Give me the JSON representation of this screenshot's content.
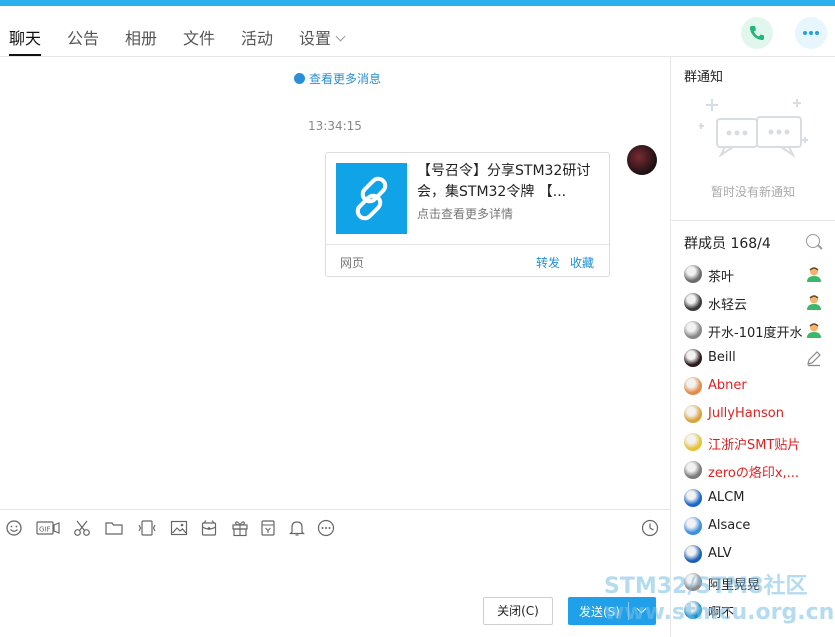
{
  "tabs": [
    {
      "label": "聊天",
      "active": true
    },
    {
      "label": "公告"
    },
    {
      "label": "相册"
    },
    {
      "label": "文件"
    },
    {
      "label": "活动"
    },
    {
      "label": "设置"
    }
  ],
  "header": {
    "phone_icon": "phone-icon",
    "more_icon": "more-icon"
  },
  "chat": {
    "more_messages": "查看更多消息",
    "timestamp": "13:34:15",
    "card": {
      "title": "【号召令】分享STM32研讨会，集STM32令牌 【...",
      "subtitle": "点击查看更多详情",
      "type": "网页",
      "forward": "转发",
      "favorite": "收藏",
      "thumb_icon": "link-icon"
    }
  },
  "toolbar": {
    "icons": [
      "emoji-icon",
      "gif-icon",
      "scissors-icon",
      "folder-icon",
      "shake-icon",
      "image-icon",
      "red-packet-icon",
      "gift-icon",
      "schedule-icon",
      "bell-icon",
      "more-icon",
      "history-icon"
    ],
    "close_label": "关闭(C)",
    "send_label": "发送(S)"
  },
  "notice": {
    "title": "群通知",
    "empty": "暂时没有新通知"
  },
  "members": {
    "title": "群成员",
    "count": "168/4",
    "list": [
      {
        "name": "茶叶",
        "color": "#222222",
        "role": "admin-icon"
      },
      {
        "name": "水轻云",
        "color": "#222222",
        "role": "admin-icon"
      },
      {
        "name": "开水-101度开水",
        "color": "#222222",
        "role": "admin-icon"
      },
      {
        "name": "Beill",
        "color": "#222222",
        "role": "edit-icon"
      },
      {
        "name": "Abner",
        "color": "#e02020"
      },
      {
        "name": "JullyHanson",
        "color": "#e02020"
      },
      {
        "name": "江浙沪SMT贴片",
        "color": "#e02020"
      },
      {
        "name": "zeroの烙印x,...",
        "color": "#e02020"
      },
      {
        "name": "ALCM",
        "color": "#222222"
      },
      {
        "name": "Alsace",
        "color": "#222222"
      },
      {
        "name": "ALV",
        "color": "#222222"
      },
      {
        "name": "阿里晃晃",
        "color": "#222222"
      },
      {
        "name": "啊不",
        "color": "#222222"
      }
    ]
  },
  "watermark": {
    "line1": "STM32/STM8社区",
    "line2": "www.stmcu.org.cn"
  },
  "colors": {
    "accent": "#1fa0e8",
    "link": "#1e90d8",
    "topbar": "#2ab0ee",
    "red_name": "#e02020"
  }
}
